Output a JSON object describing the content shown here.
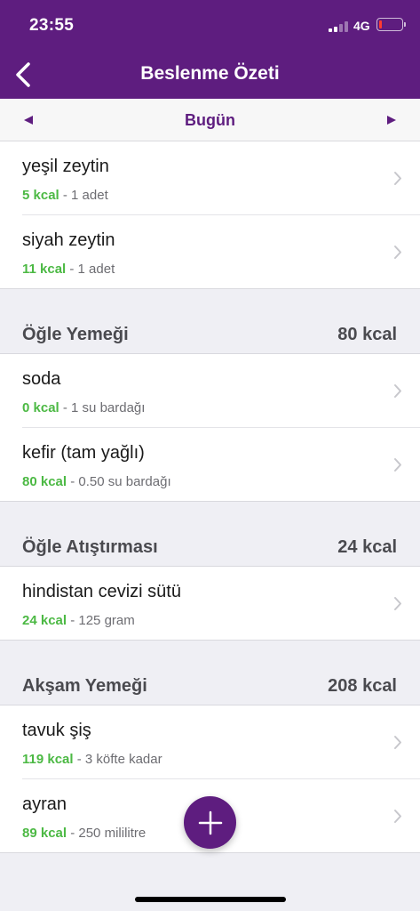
{
  "status": {
    "time": "23:55",
    "network": "4G",
    "battery_level": 0.1
  },
  "nav": {
    "title": "Beslenme Özeti",
    "back_icon": "chevron-left-icon"
  },
  "date": {
    "label": "Bugün",
    "prev_icon": "triangle-left-icon",
    "next_icon": "triangle-right-icon"
  },
  "colors": {
    "brand": "#5e1d7f",
    "kcal_green": "#4cb944",
    "background": "#efeff4"
  },
  "top_items": [
    {
      "name": "yeşil zeytin",
      "kcal": "5 kcal",
      "portion": " - 1 adet"
    },
    {
      "name": "siyah zeytin",
      "kcal": "11 kcal",
      "portion": " - 1 adet"
    }
  ],
  "sections": [
    {
      "title": "Öğle Yemeği",
      "total": "80 kcal",
      "items": [
        {
          "name": "soda",
          "kcal": "0 kcal",
          "portion": " - 1 su bardağı"
        },
        {
          "name": "kefir (tam yağlı)",
          "kcal": "80 kcal",
          "portion": " - 0.50 su bardağı"
        }
      ]
    },
    {
      "title": "Öğle Atıştırması",
      "total": "24 kcal",
      "items": [
        {
          "name": "hindistan cevizi sütü",
          "kcal": "24 kcal",
          "portion": " - 125 gram"
        }
      ]
    },
    {
      "title": "Akşam Yemeği",
      "total": "208 kcal",
      "items": [
        {
          "name": "tavuk şiş",
          "kcal": "119 kcal",
          "portion": " - 3 köfte kadar"
        },
        {
          "name": "ayran",
          "kcal": "89 kcal",
          "portion": " - 250 mililitre"
        }
      ]
    }
  ],
  "fab": {
    "icon": "plus-icon"
  }
}
